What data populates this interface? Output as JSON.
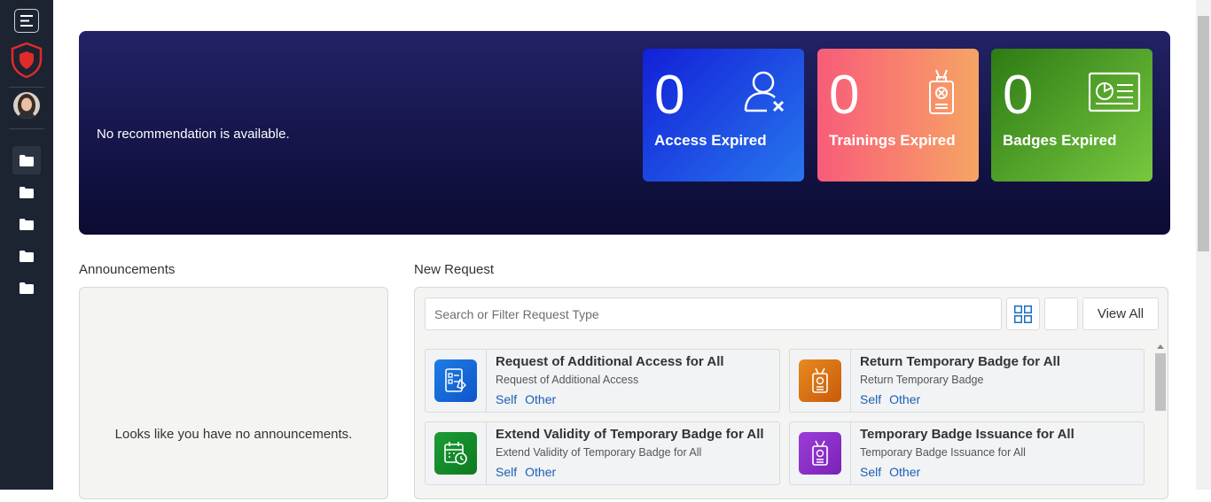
{
  "sidebar": {
    "menu_icon": "hamburger-icon",
    "logo_icon": "shield-icon",
    "avatar_icon": "user-avatar",
    "folders": [
      "folder-icon",
      "folder-icon",
      "folder-icon",
      "folder-icon",
      "folder-icon"
    ]
  },
  "hero": {
    "recommendation": "No recommendation is available.",
    "stats": [
      {
        "value": "0",
        "label": "Access Expired",
        "icon": "user-x-icon"
      },
      {
        "value": "0",
        "label": "Trainings Expired",
        "icon": "badge-x-icon"
      },
      {
        "value": "0",
        "label": "Badges Expired",
        "icon": "id-card-icon"
      }
    ]
  },
  "announcements": {
    "title": "Announcements",
    "empty": "Looks like you have no announcements."
  },
  "new_request": {
    "title": "New Request",
    "search_placeholder": "Search or Filter Request Type",
    "view_all": "View All",
    "cards": [
      {
        "title": "Request of Additional Access for All",
        "subtitle": "Request of Additional Access",
        "self": "Self",
        "other": "Other",
        "color": "#1565d8",
        "icon": "checklist-icon"
      },
      {
        "title": "Return Temporary Badge for All",
        "subtitle": "Return Temporary Badge",
        "self": "Self",
        "other": "Other",
        "color": "#d86a10",
        "icon": "badge-icon"
      },
      {
        "title": "Extend Validity of Temporary Badge for All",
        "subtitle": "Extend Validity of Temporary Badge for All",
        "self": "Self",
        "other": "Other",
        "color": "#118a28",
        "icon": "calendar-clock-icon"
      },
      {
        "title": "Temporary Badge Issuance for All",
        "subtitle": "Temporary Badge Issuance for All",
        "self": "Self",
        "other": "Other",
        "color": "#8a2bc8",
        "icon": "badge-icon"
      }
    ]
  }
}
